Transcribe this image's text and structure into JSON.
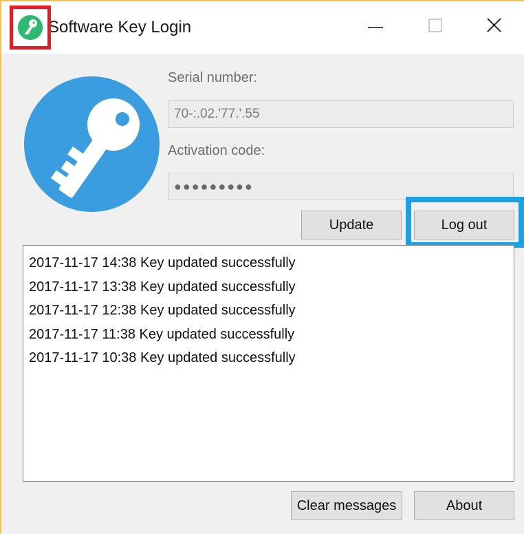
{
  "window": {
    "title": "Software Key Login",
    "app_icon": "green-key-icon",
    "controls": [
      "minimize-icon",
      "maximize-icon",
      "close-icon"
    ]
  },
  "logo": {
    "icon": "key-icon",
    "color": "#3a9de0"
  },
  "form": {
    "serial_label": "Serial number:",
    "serial_value": "70-:.02.'77.'.55",
    "activation_label": "Activation code:",
    "activation_value": "●●●●●●●●●"
  },
  "buttons": {
    "update": "Update",
    "logout": "Log out",
    "clear": "Clear messages",
    "about": "About"
  },
  "messages": [
    "2017-11-17 14:38 Key updated successfully",
    "2017-11-17 13:38 Key updated successfully",
    "2017-11-17 12:38 Key updated successfully",
    "2017-11-17 11:38 Key updated successfully",
    "2017-11-17 10:38 Key updated successfully"
  ],
  "highlights": {
    "app_icon_color": "#e31d23",
    "logout_color": "#1aa1e3"
  }
}
